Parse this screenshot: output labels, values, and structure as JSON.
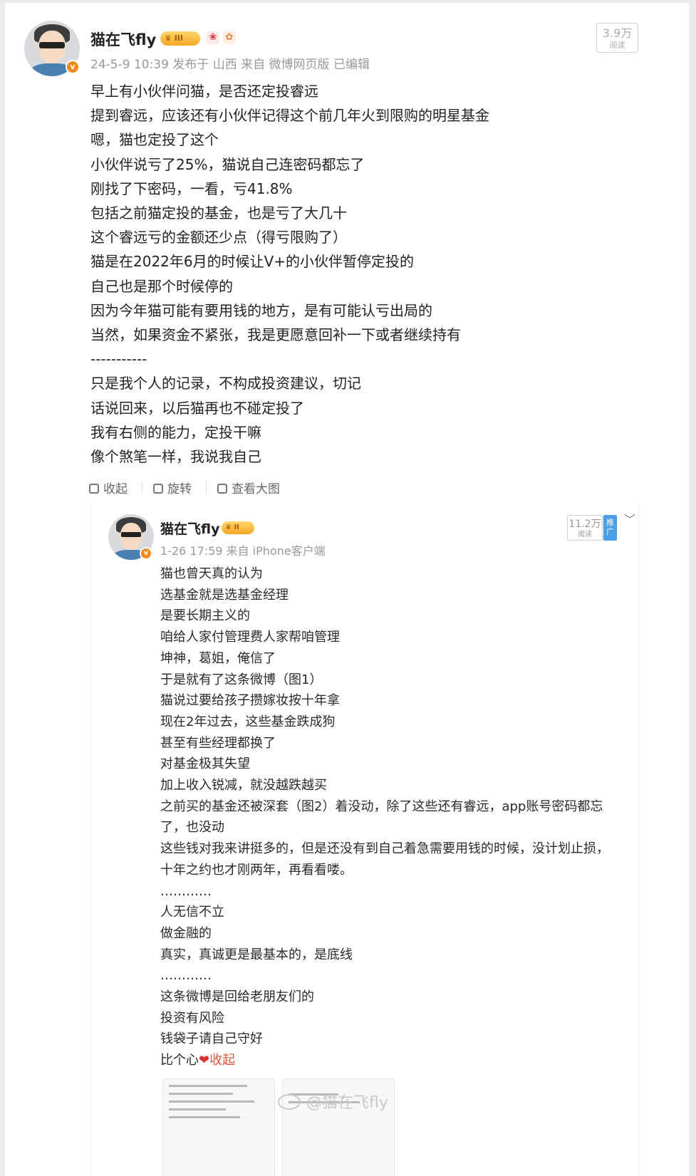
{
  "post": {
    "author": "猫在飞fly",
    "level_badge": "III",
    "verified_badge": "v",
    "meta": "24-5-9 10:39 发布于 山西 来自 微博网页版 已编辑",
    "reads": {
      "count": "3.9万",
      "label": "阅读"
    },
    "lines": [
      "早上有小伙伴问猫，是否还定投睿远",
      "提到睿远，应该还有小伙伴记得这个前几年火到限购的明星基金",
      "嗯，猫也定投了这个",
      "小伙伴说亏了25%，猫说自己连密码都忘了",
      "刚找了下密码，一看，亏41.8%",
      "包括之前猫定投的基金，也是亏了大几十",
      "这个睿远亏的金额还少点（得亏限购了）",
      "猫是在2022年6月的时候让V+的小伙伴暂停定投的",
      "自己也是那个时候停的",
      "因为今年猫可能有要用钱的地方，是有可能认亏出局的",
      "当然，如果资金不紧张，我是更愿意回补一下或者继续持有",
      "-----------",
      "只是我个人的记录，不构成投资建议，切记",
      "话说回来，以后猫再也不碰定投了",
      "我有右侧的能力，定投干嘛",
      "像个煞笔一样，我说我自己"
    ]
  },
  "toolbar": {
    "collapse": "收起",
    "rotate": "旋转",
    "view_large": "查看大图"
  },
  "image": {
    "author": "猫在飞fly",
    "level_badge": "II",
    "verified_badge": "v",
    "meta": "1-26 17:59 来自 iPhone客户端",
    "reads": {
      "count": "11.2万",
      "label": "阅读"
    },
    "promo": "推广",
    "lines": [
      "猫也曾天真的认为",
      "选基金就是选基金经理",
      "是要长期主义的",
      "咱给人家付管理费人家帮咱管理",
      "坤神，葛姐，俺信了",
      "于是就有了这条微博（图1）",
      "猫说过要给孩子攒嫁妆按十年拿",
      "现在2年过去，这些基金跌成狗",
      "甚至有些经理都换了",
      "对基金极其失望",
      "加上收入锐减，就没越跌越买",
      "之前买的基金还被深套（图2）着没动，除了这些还有睿远，app账号密码都忘",
      "了，也没动",
      " 这些钱对我来讲挺多的，但是还没有到自己着急需要用钱的时候，没计划止损，",
      "十年之约也才刚两年，再看看喽。",
      "…………",
      "人无信不立",
      "做金融的",
      "真实，真诚更是最基本的，是底线",
      "…………",
      "这条微博是回给老朋友们的",
      "投资有风险",
      "钱袋子请自己守好",
      "比个心"
    ],
    "heart": "❤",
    "collapse_link": "收起",
    "watermark": "@猫在飞fly"
  }
}
